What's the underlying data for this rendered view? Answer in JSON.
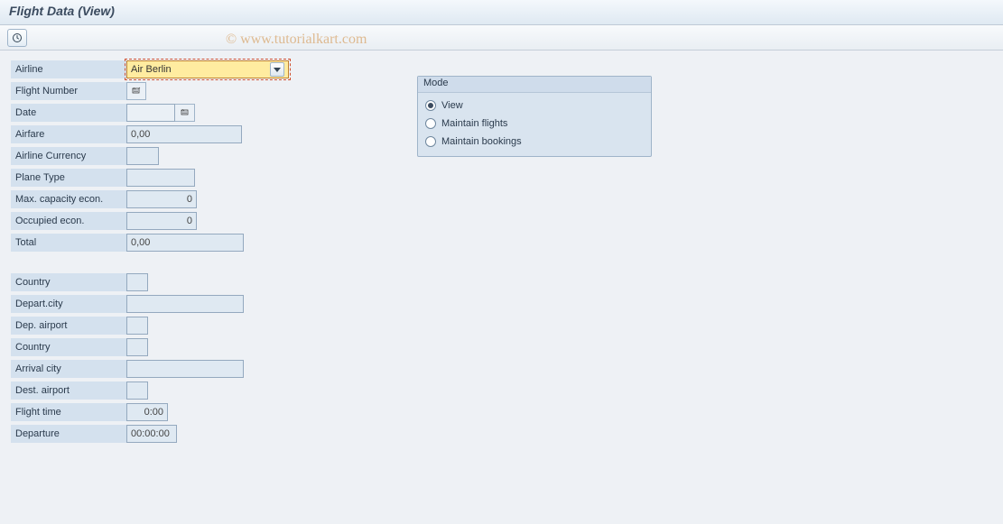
{
  "title": "Flight Data (View)",
  "watermark": "© www.tutorialkart.com",
  "toolbar": {},
  "fields": {
    "airline": {
      "label": "Airline",
      "value": "Air Berlin"
    },
    "flight_number": {
      "label": "Flight Number",
      "value": ""
    },
    "date": {
      "label": "Date",
      "value": ""
    },
    "airfare": {
      "label": "Airfare",
      "value": "0,00"
    },
    "airline_currency": {
      "label": "Airline Currency",
      "value": ""
    },
    "plane_type": {
      "label": "Plane Type",
      "value": ""
    },
    "max_cap_econ": {
      "label": "Max. capacity econ.",
      "value": "0"
    },
    "occupied_econ": {
      "label": "Occupied econ.",
      "value": "0"
    },
    "total": {
      "label": "Total",
      "value": "0,00"
    },
    "country_from": {
      "label": "Country",
      "value": ""
    },
    "depart_city": {
      "label": "Depart.city",
      "value": ""
    },
    "dep_airport": {
      "label": "Dep. airport",
      "value": ""
    },
    "country_to": {
      "label": "Country",
      "value": ""
    },
    "arrival_city": {
      "label": "Arrival city",
      "value": ""
    },
    "dest_airport": {
      "label": "Dest. airport",
      "value": ""
    },
    "flight_time": {
      "label": "Flight time",
      "value": "  0:00"
    },
    "departure": {
      "label": "Departure",
      "value": "00:00:00"
    }
  },
  "mode": {
    "title": "Mode",
    "options": {
      "view": "View",
      "maintain_flights": "Maintain flights",
      "maintain_bookings": "Maintain bookings"
    },
    "selected": "view"
  }
}
